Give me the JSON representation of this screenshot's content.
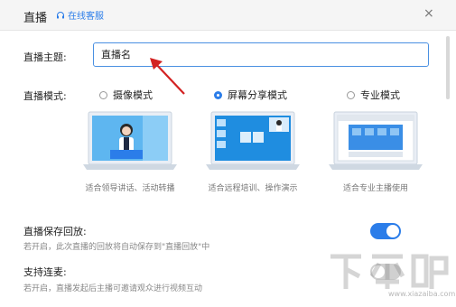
{
  "window": {
    "title": "直播",
    "support_link": "在线客服",
    "close_glyph": "×"
  },
  "topic": {
    "label": "直播主题:",
    "value": "直播名"
  },
  "mode": {
    "label": "直播模式:",
    "options": [
      {
        "label": "摄像模式",
        "selected": false,
        "caption": "适合领导讲话、活动转播"
      },
      {
        "label": "屏幕分享模式",
        "selected": true,
        "caption": "适合远程培训、操作演示"
      },
      {
        "label": "专业模式",
        "selected": false,
        "caption": "适合专业主播使用"
      }
    ]
  },
  "settings": {
    "save_replay": {
      "title": "直播保存回放:",
      "desc": "若开启，此次直播的回放将自动保存到\"直播回放\"中",
      "enabled": true
    },
    "co_host": {
      "title": "支持连麦:",
      "desc": "若开启，直播发起后主播可邀请观众进行视频互动",
      "enabled": false
    }
  },
  "watermark": {
    "text": "下载吧",
    "url": "www.xiazaiba.com"
  },
  "colors": {
    "accent": "#2b7de9",
    "toggle_on": "#2b7de9",
    "toggle_off": "#d0d0d0"
  }
}
